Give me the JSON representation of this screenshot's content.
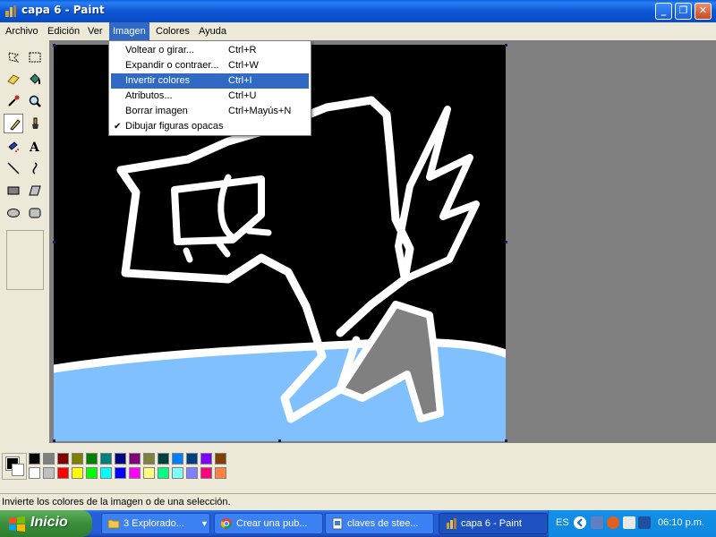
{
  "window": {
    "title": "capa 6 - Paint",
    "buttons": [
      "_",
      "❐",
      "✕"
    ]
  },
  "menubar": {
    "items": [
      "Archivo",
      "Edición",
      "Ver",
      "Imagen",
      "Colores",
      "Ayuda"
    ],
    "active": "Imagen"
  },
  "imagen_menu": {
    "items": [
      {
        "label": "Voltear o girar...",
        "shortcut": "Ctrl+R"
      },
      {
        "label": "Expandir o contraer...",
        "shortcut": "Ctrl+W"
      },
      {
        "label": "Invertir colores",
        "shortcut": "Ctrl+I",
        "highlighted": true
      },
      {
        "label": "Atributos...",
        "shortcut": "Ctrl+U"
      },
      {
        "label": "Borrar imagen",
        "shortcut": "Ctrl+Mayús+N"
      },
      {
        "label": "Dibujar figuras opacas",
        "shortcut": "",
        "checked": true
      }
    ]
  },
  "toolbox": {
    "tools": [
      "free-select-icon",
      "rect-select-icon",
      "eraser-icon",
      "fill-icon",
      "color-picker-icon",
      "magnifier-icon",
      "pencil-icon",
      "brush-icon",
      "airbrush-icon",
      "text-icon",
      "line-icon",
      "curve-icon",
      "rectangle-icon",
      "polygon-icon",
      "ellipse-icon",
      "rounded-rect-icon"
    ],
    "selected": "pencil-icon"
  },
  "palette": {
    "foreground": "#000000",
    "background": "#ffffff",
    "row1": [
      "#000000",
      "#808080",
      "#800000",
      "#808000",
      "#008000",
      "#008080",
      "#000080",
      "#800080",
      "#808040",
      "#004040",
      "#0080ff",
      "#004080",
      "#8000ff",
      "#804000"
    ],
    "row2": [
      "#ffffff",
      "#c0c0c0",
      "#ff0000",
      "#ffff00",
      "#00ff00",
      "#00ffff",
      "#0000ff",
      "#ff00ff",
      "#ffff80",
      "#00ff80",
      "#80ffff",
      "#8080ff",
      "#ff0080",
      "#ff8040"
    ]
  },
  "status": {
    "text": "Invierte los colores de la imagen o de una selección."
  },
  "taskbar": {
    "start_label": "Inicio",
    "tasks": [
      {
        "label": "3 Explorado...",
        "icon": "folder-icon"
      },
      {
        "label": "Crear una pub...",
        "icon": "chrome-icon"
      },
      {
        "label": "claves de stee...",
        "icon": "paint-doc-icon"
      },
      {
        "label": "capa 6 - Paint",
        "icon": "paint-icon",
        "active": true
      }
    ],
    "language": "ES",
    "clock": "06:10 p.m."
  }
}
